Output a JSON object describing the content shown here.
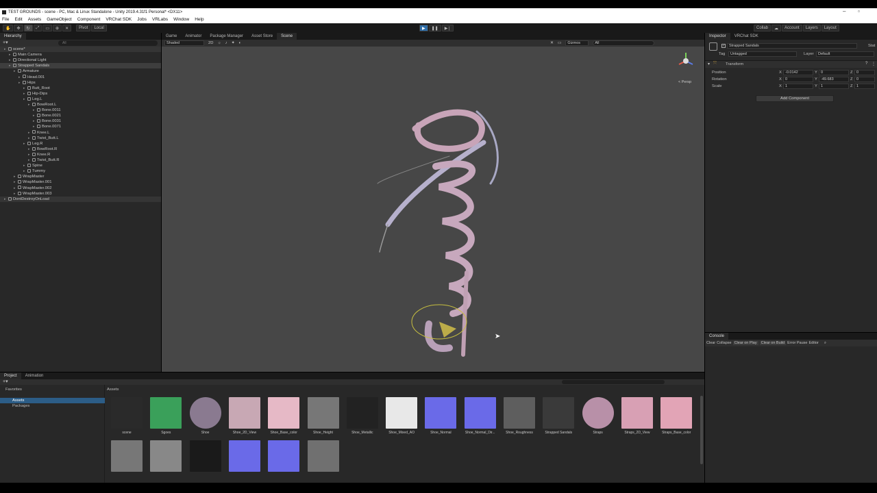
{
  "window": {
    "title": "TEST GROUNDS - scene - PC, Mac & Linux Standalone - Unity 2019.4.31f1 Personal* <DX11>"
  },
  "menu": [
    "File",
    "Edit",
    "Assets",
    "GameObject",
    "Component",
    "VRChat SDK",
    "Jobs",
    "VRLabs",
    "Window",
    "Help"
  ],
  "toolbar": {
    "pivot": "Pivot",
    "local": "Local",
    "collab": "Collab",
    "account": "Account",
    "layers": "Layers",
    "layout": "Layout"
  },
  "hierarchy": {
    "tab": "Hierarchy",
    "search_placeholder": "All",
    "items": [
      {
        "label": "scene*",
        "depth": 0
      },
      {
        "label": "Main Camera",
        "depth": 1
      },
      {
        "label": "Directional Light",
        "depth": 1
      },
      {
        "label": "Strapped Sandals",
        "depth": 1
      },
      {
        "label": "Armature",
        "depth": 2
      },
      {
        "label": "Head.001",
        "depth": 3
      },
      {
        "label": "Hips",
        "depth": 3
      },
      {
        "label": "Butt_Root",
        "depth": 4
      },
      {
        "label": "Hip-Dips",
        "depth": 4
      },
      {
        "label": "Leg.L",
        "depth": 4
      },
      {
        "label": "BowRoot.L",
        "depth": 5
      },
      {
        "label": "Bone.0011",
        "depth": 6
      },
      {
        "label": "Bone.0021",
        "depth": 6
      },
      {
        "label": "Bone.0031",
        "depth": 6
      },
      {
        "label": "Bone.0071",
        "depth": 6
      },
      {
        "label": "Knee.L",
        "depth": 5
      },
      {
        "label": "Twist_Butt.L",
        "depth": 5
      },
      {
        "label": "Leg.R",
        "depth": 4
      },
      {
        "label": "BowRoot.R",
        "depth": 5
      },
      {
        "label": "Knee.R",
        "depth": 5
      },
      {
        "label": "Twist_Butt.R",
        "depth": 5
      },
      {
        "label": "Spine",
        "depth": 4
      },
      {
        "label": "Tummy",
        "depth": 4
      },
      {
        "label": "WrapMaster",
        "depth": 2
      },
      {
        "label": "WrapMaster.001",
        "depth": 2
      },
      {
        "label": "WrapMaster.002",
        "depth": 2
      },
      {
        "label": "WrapMaster.003",
        "depth": 2
      },
      {
        "label": "DontDestroyOnLoad",
        "depth": 0
      }
    ]
  },
  "center_tabs": [
    "Game",
    "Animator",
    "Package Manager",
    "Asset Store",
    "Scene"
  ],
  "scene_bar": {
    "shading": "Shaded",
    "mode": "2D",
    "gizmos": "Gizmos",
    "search": "All",
    "persp": "< Persp"
  },
  "inspector": {
    "tabs": [
      "Inspector",
      "VRChat SDK"
    ],
    "object_name": "Strapped Sandals",
    "static_label": "Stat",
    "tag_label": "Tag",
    "tag_value": "Untagged",
    "layer_label": "Layer",
    "layer_value": "Default",
    "component": "Transform",
    "position": {
      "label": "Position",
      "x": "-0.0142",
      "y": "0",
      "z": "0"
    },
    "rotation": {
      "label": "Rotation",
      "x": "0",
      "y": "-49.683",
      "z": "0"
    },
    "scale": {
      "label": "Scale",
      "x": "1",
      "y": "1",
      "z": "1"
    },
    "add_component": "Add Component"
  },
  "console": {
    "tab": "Console",
    "buttons": [
      "Clear",
      "Collapse",
      "Clear on Play",
      "Clear on Build",
      "Error Pause",
      "Editor"
    ]
  },
  "project": {
    "tabs": [
      "Project",
      "Animation"
    ],
    "favorites": "Favorites",
    "assets_root": "Assets",
    "packages": "Packages",
    "breadcrumb": "Assets",
    "assets": [
      {
        "label": "scene",
        "color": "#2a2a2a"
      },
      {
        "label": "Sgoes",
        "color": "#3aa05a"
      },
      {
        "label": "Shoe",
        "color": "#8a7a90"
      },
      {
        "label": "Shoe_2D_View",
        "color": "#c8a8b4"
      },
      {
        "label": "Shoe_Base_color",
        "color": "#e6b9c6"
      },
      {
        "label": "Shoe_Height",
        "color": "#777777"
      },
      {
        "label": "Shoe_Metallic",
        "color": "#222222"
      },
      {
        "label": "Shoe_Mixed_AO",
        "color": "#e8e8e8"
      },
      {
        "label": "Shoe_Normal",
        "color": "#6a6ae8"
      },
      {
        "label": "Shoe_Normal_Dir...",
        "color": "#6a6ae8"
      },
      {
        "label": "Shoe_Roughness",
        "color": "#5e5e5e"
      },
      {
        "label": "Strapped Sandals",
        "color": "#3a3a3a"
      },
      {
        "label": "Straps",
        "color": "#b890a8"
      },
      {
        "label": "Straps_2D_View",
        "color": "#d8a0b4"
      },
      {
        "label": "Straps_Base_color",
        "color": "#e2a4b6"
      },
      {
        "label": "",
        "color": "#777777"
      },
      {
        "label": "",
        "color": "#888888"
      },
      {
        "label": "",
        "color": "#1a1a1a"
      },
      {
        "label": "",
        "color": "#6a6ae8"
      },
      {
        "label": "",
        "color": "#6a6ae8"
      },
      {
        "label": "",
        "color": "#707070"
      }
    ]
  }
}
